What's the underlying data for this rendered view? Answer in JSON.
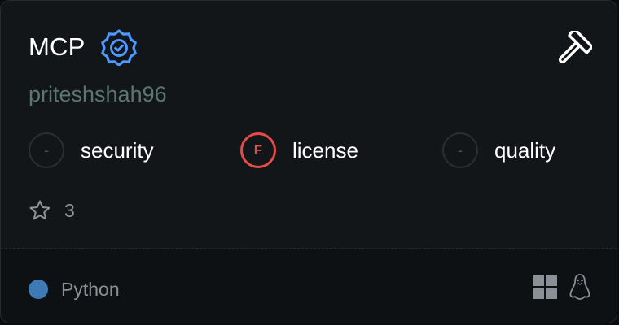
{
  "server": {
    "name": "MCP",
    "author": "priteshshah96",
    "verified_icon": "verified-badge-icon",
    "tool_icon": "hammer-icon"
  },
  "grades": [
    {
      "label": "security",
      "grade": "-",
      "status": "none"
    },
    {
      "label": "license",
      "grade": "F",
      "status": "fail"
    },
    {
      "label": "quality",
      "grade": "-",
      "status": "none"
    }
  ],
  "stars": {
    "icon": "star-outline-icon",
    "count": "3"
  },
  "footer": {
    "language": "Python",
    "language_color": "#3e7ab6",
    "platforms": [
      "windows-icon",
      "linux-icon"
    ]
  },
  "colors": {
    "accent_blue": "#4f98ff",
    "fail_red": "#e64a4a",
    "author_green": "#5b7570"
  }
}
